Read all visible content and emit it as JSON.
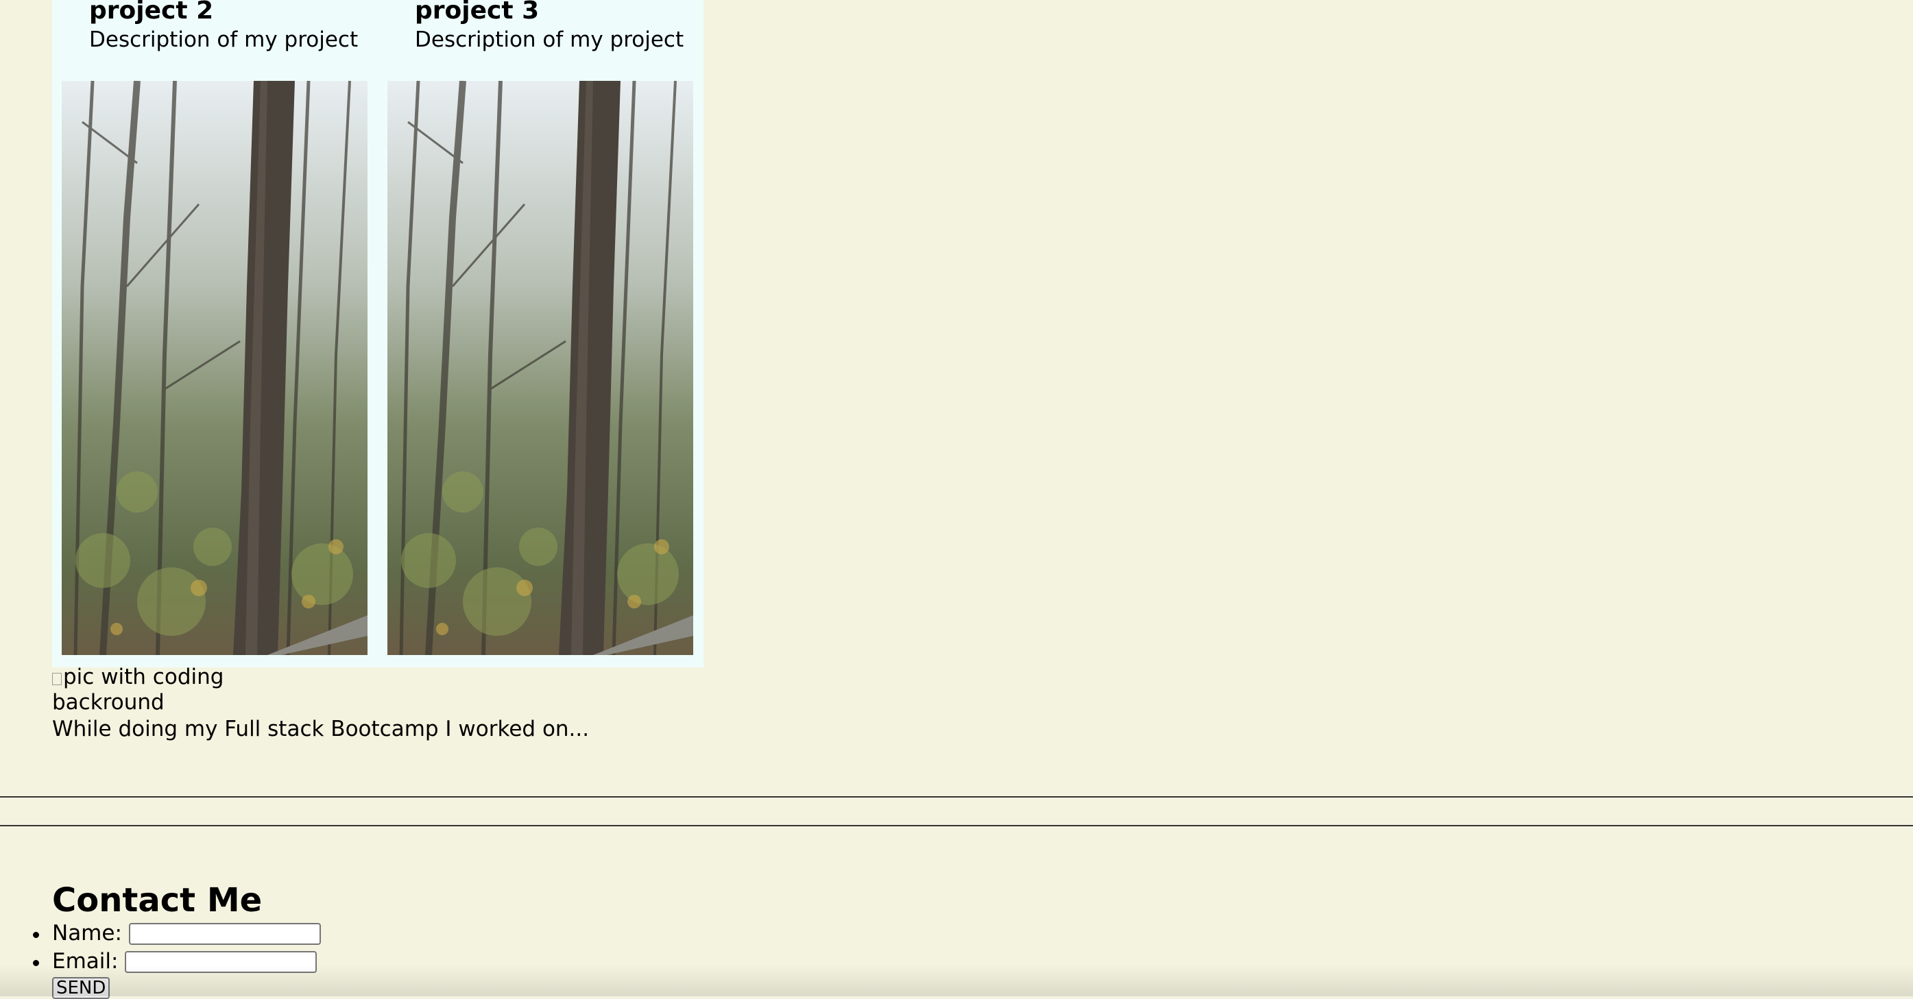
{
  "projects": [
    {
      "title": "project 2",
      "description": "Description of my project",
      "image_icon": "forest-photo"
    },
    {
      "title": "project 3",
      "description": "Description of my project",
      "image_icon": "forest-photo"
    }
  ],
  "about": {
    "image_alt": "pic with coding backround",
    "text": "While doing my Full stack Bootcamp I worked on..."
  },
  "contact": {
    "heading": "Contact Me",
    "name_label": "Name:",
    "name_value": "",
    "email_label": "Email:",
    "email_value": "",
    "send_label": "SEND"
  },
  "colors": {
    "page_background": "#f4f3df",
    "projects_panel_background": "#eefdfb"
  }
}
